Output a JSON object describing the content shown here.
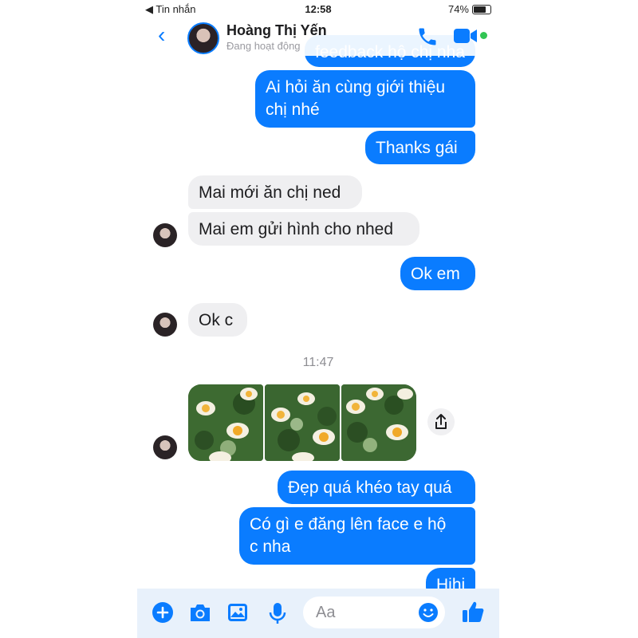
{
  "status": {
    "carrier_back": "◀ Tin nhắn",
    "time": "12:58",
    "battery": "74%"
  },
  "header": {
    "contact_name": "Hoàng Thị Yến",
    "contact_status": "Đang hoạt động"
  },
  "colors": {
    "accent": "#0a7cff",
    "incoming": "#efeff1",
    "online": "#31c553"
  },
  "messages": {
    "partial_top": "feedback hộ chị nha",
    "m1": "Ai hỏi ăn cùng giới thiệu",
    "m1b": "chị nhé",
    "m2": "Thanks gái",
    "m3": "Mai mới ăn chị ned",
    "m4": "Mai em gửi hình cho nhed",
    "m5": "Ok em",
    "m6": "Ok c",
    "timestamp": "11:47",
    "m7": "Đẹp quá khéo tay quá",
    "m8": "Có gì e đăng lên face e hộ",
    "m8b": "c nha",
    "m9": "Hihi"
  },
  "composer": {
    "placeholder": "Aa"
  }
}
